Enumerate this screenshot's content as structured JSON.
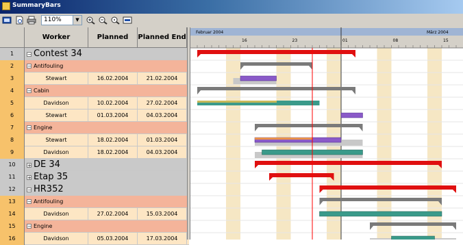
{
  "window": {
    "title": "SummaryBars"
  },
  "toolbar": {
    "zoom_value": "110%"
  },
  "grid": {
    "headers": {
      "worker": "Worker",
      "planned_start": "Planned Start",
      "planned_end": "Planned End"
    },
    "rows": [
      {
        "num": "1",
        "kind": "summary",
        "label": "Contest 34",
        "start": "",
        "end": ""
      },
      {
        "num": "2",
        "kind": "group",
        "label": "Antifouling",
        "start": "",
        "end": ""
      },
      {
        "num": "3",
        "kind": "task",
        "label": "Stewart",
        "start": "16.02.2004",
        "end": "21.02.2004"
      },
      {
        "num": "4",
        "kind": "group",
        "label": "Cabin",
        "start": "",
        "end": ""
      },
      {
        "num": "5",
        "kind": "task",
        "label": "Davidson",
        "start": "10.02.2004",
        "end": "27.02.2004"
      },
      {
        "num": "6",
        "kind": "task",
        "label": "Stewart",
        "start": "01.03.2004",
        "end": "04.03.2004"
      },
      {
        "num": "7",
        "kind": "group",
        "label": "Engine",
        "start": "",
        "end": ""
      },
      {
        "num": "8",
        "kind": "task",
        "label": "Stewart",
        "start": "18.02.2004",
        "end": "01.03.2004"
      },
      {
        "num": "9",
        "kind": "task",
        "label": "Davidson",
        "start": "18.02.2004",
        "end": "04.03.2004"
      },
      {
        "num": "10",
        "kind": "summary",
        "label": "DE 34",
        "start": "",
        "end": ""
      },
      {
        "num": "11",
        "kind": "summary",
        "label": "Etap 35",
        "start": "",
        "end": ""
      },
      {
        "num": "12",
        "kind": "summary",
        "label": "HR352",
        "start": "",
        "end": ""
      },
      {
        "num": "13",
        "kind": "group",
        "label": "Antifouling",
        "start": "",
        "end": ""
      },
      {
        "num": "14",
        "kind": "task",
        "label": "Davidson",
        "start": "27.02.2004",
        "end": "15.03.2004"
      },
      {
        "num": "15",
        "kind": "group",
        "label": "Engine",
        "start": "",
        "end": ""
      },
      {
        "num": "16",
        "kind": "task",
        "label": "Davidson",
        "start": "05.03.2004",
        "end": "17.03.2004"
      }
    ]
  },
  "timescale": {
    "months": [
      {
        "label": "Februar 2004",
        "date": "2004-02-01"
      },
      {
        "label": "März 2004",
        "date": "2004-03-01"
      }
    ],
    "weeks": [
      {
        "label": "16",
        "date": "2004-02-16"
      },
      {
        "label": "23",
        "date": "2004-02-23"
      },
      {
        "label": "01",
        "date": "2004-03-01"
      },
      {
        "label": "08",
        "date": "2004-03-08"
      },
      {
        "label": "15",
        "date": "2004-03-15"
      }
    ],
    "visible_start": "2004-02-10",
    "visible_end": "2004-03-17",
    "today": "2004-02-26"
  },
  "gantt": {
    "bars": [
      {
        "row": 0,
        "type": "summary",
        "start": "2004-02-10",
        "end": "2004-03-03"
      },
      {
        "row": 1,
        "type": "group",
        "start": "2004-02-16",
        "end": "2004-02-26"
      },
      {
        "row": 2,
        "type": "task",
        "start": "2004-02-16",
        "end": "2004-02-21",
        "baseline_start": "2004-02-15",
        "baseline_end": "2004-02-21"
      },
      {
        "row": 3,
        "type": "group",
        "start": "2004-02-10",
        "end": "2004-03-03"
      },
      {
        "row": 4,
        "type": "split",
        "start": "2004-02-10",
        "end": "2004-02-27"
      },
      {
        "row": 5,
        "type": "task",
        "start": "2004-03-01",
        "end": "2004-03-04"
      },
      {
        "row": 6,
        "type": "group",
        "start": "2004-02-18",
        "end": "2004-03-04"
      },
      {
        "row": 7,
        "type": "task",
        "start": "2004-02-18",
        "end": "2004-03-01",
        "baseline_start": "2004-02-18",
        "baseline_end": "2004-03-04"
      },
      {
        "row": 8,
        "type": "teal",
        "start": "2004-02-19",
        "end": "2004-03-04",
        "baseline_start": "2004-02-18",
        "baseline_end": "2004-03-04"
      },
      {
        "row": 9,
        "type": "summary",
        "start": "2004-02-18",
        "end": "2004-03-15"
      },
      {
        "row": 10,
        "type": "summary",
        "start": "2004-02-20",
        "end": "2004-02-29"
      },
      {
        "row": 11,
        "type": "summary",
        "start": "2004-02-27",
        "end": "2004-03-17"
      },
      {
        "row": 12,
        "type": "group",
        "start": "2004-02-27",
        "end": "2004-03-15"
      },
      {
        "row": 13,
        "type": "teal",
        "start": "2004-02-27",
        "end": "2004-03-15"
      },
      {
        "row": 14,
        "type": "group",
        "start": "2004-03-05",
        "end": "2004-03-17"
      },
      {
        "row": 15,
        "type": "teal",
        "start": "2004-03-08",
        "end": "2004-03-14",
        "baseline_start": "2004-03-05",
        "baseline_end": "2004-03-17"
      }
    ]
  },
  "colors": {
    "summary_bar": "#e01010",
    "group_bar": "#7a7a7a",
    "task_bar": "#8a5ac8",
    "teal_bar": "#3a9a8a",
    "split_bar": "#c8b85a",
    "baseline": "#c8c8c8",
    "weekend_band": "#f6e7c4",
    "today_line": "#ff0000",
    "group_row": "#f4b49a",
    "task_row": "#fde6c4",
    "summary_row": "#c9c9c9"
  },
  "icons": [
    "app-icon",
    "print-preview-icon",
    "print-icon",
    "zoom-in-icon",
    "zoom-out-icon",
    "zoom-reset-icon",
    "fit-icon"
  ]
}
